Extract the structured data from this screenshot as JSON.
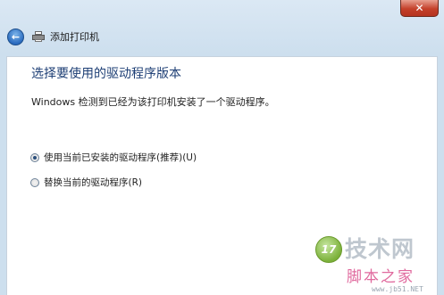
{
  "window": {
    "close_glyph": "✕",
    "title": "添加打印机"
  },
  "nav": {
    "back_glyph": "←"
  },
  "content": {
    "heading": "选择要使用的驱动程序版本",
    "description": "Windows 检测到已经为该打印机安装了一个驱动程序。",
    "options": [
      {
        "label": "使用当前已安装的驱动程序(推荐)(U)",
        "selected": true
      },
      {
        "label": "替换当前的驱动程序(R)",
        "selected": false
      }
    ]
  },
  "watermark": {
    "badge": "17",
    "main": "技术网",
    "sub": "脚本之家",
    "url": "www.jb51.NET"
  }
}
